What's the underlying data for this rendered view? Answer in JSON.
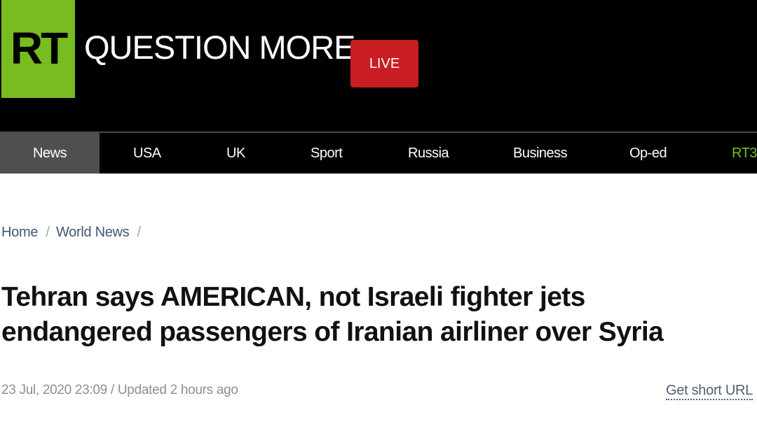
{
  "header": {
    "logo_text": "RT",
    "tagline": "QUESTION MORE",
    "live_label": "LIVE",
    "colors": {
      "logo_green": "#77bd1f",
      "live_red": "#c81d22",
      "background": "#000000"
    }
  },
  "nav": {
    "items": [
      {
        "label": "News",
        "active": true
      },
      {
        "label": "USA"
      },
      {
        "label": "UK"
      },
      {
        "label": "Sport"
      },
      {
        "label": "Russia"
      },
      {
        "label": "Business"
      },
      {
        "label": "Op-ed"
      },
      {
        "label": "RT3"
      }
    ]
  },
  "breadcrumb": {
    "items": [
      "Home",
      "World News"
    ],
    "separator": "/"
  },
  "article": {
    "headline": "Tehran says AMERICAN, not Israeli fighter jets endangered passengers of Iranian airliner over Syria",
    "meta": "23 Jul, 2020 23:09 / Updated 2 hours ago",
    "short_url_label": "Get short URL"
  }
}
